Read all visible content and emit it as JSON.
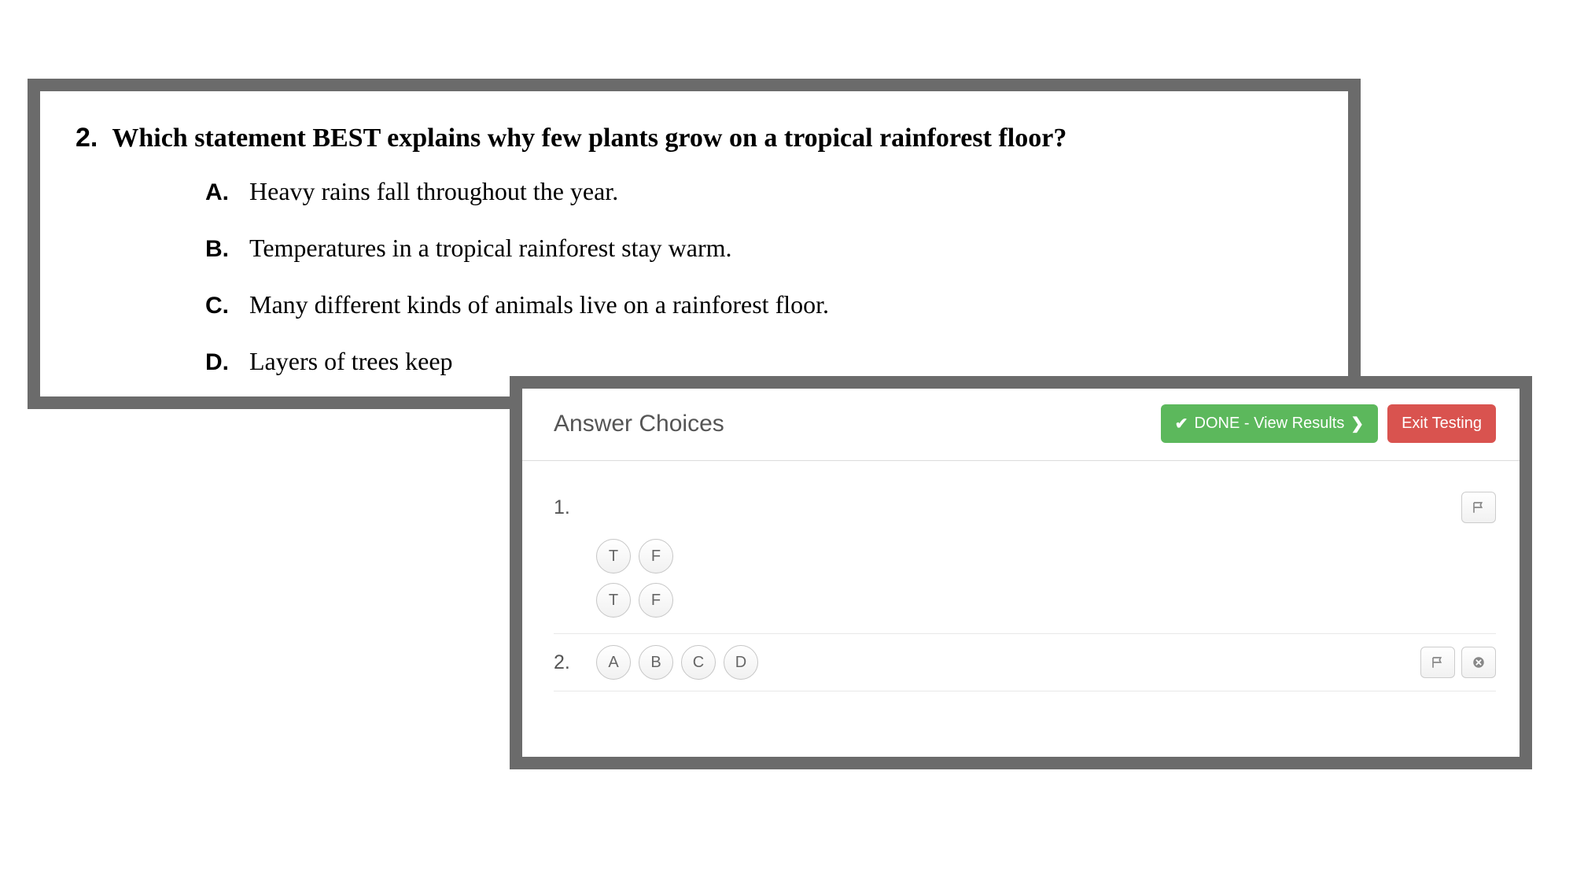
{
  "question": {
    "number": "2.",
    "text": "Which statement BEST explains why few plants grow on a tropical rainforest floor?",
    "choices": [
      {
        "letter": "A.",
        "text": "Heavy rains fall throughout the year."
      },
      {
        "letter": "B.",
        "text": "Temperatures in a tropical rainforest stay warm."
      },
      {
        "letter": "C.",
        "text": "Many different kinds of animals live on a rainforest floor."
      },
      {
        "letter": "D.",
        "text": "Layers of trees keep"
      }
    ]
  },
  "answer_panel": {
    "title": "Answer Choices",
    "done_label": "DONE - View Results",
    "exit_label": "Exit Testing",
    "rows": [
      {
        "number": "1.",
        "tf_rows": [
          {
            "t": "T",
            "f": "F"
          },
          {
            "t": "T",
            "f": "F"
          }
        ],
        "actions": [
          "flag"
        ]
      },
      {
        "number": "2.",
        "abcd": {
          "a": "A",
          "b": "B",
          "c": "C",
          "d": "D"
        },
        "actions": [
          "flag",
          "clear"
        ]
      }
    ]
  }
}
